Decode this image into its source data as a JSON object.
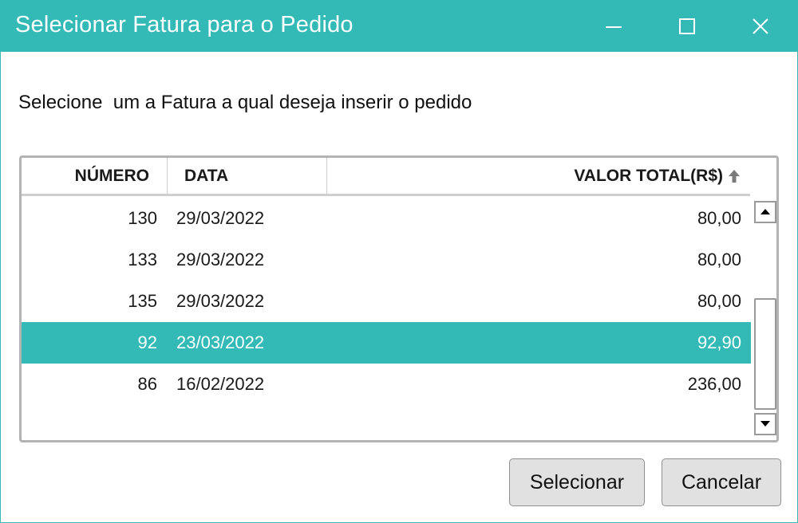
{
  "window": {
    "title": "Selecionar Fatura para o Pedido",
    "accent_color": "#34bab6"
  },
  "prompt": "Selecione  um a Fatura a qual deseja inserir o pedido",
  "grid": {
    "columns": [
      {
        "label": "NÚMERO"
      },
      {
        "label": "DATA"
      },
      {
        "label": "VALOR TOTAL(R$)",
        "sort": "ascending",
        "sort_icon": "arrow-up-icon"
      }
    ],
    "rows": [
      {
        "numero": "130",
        "data": "29/03/2022",
        "valor": "80,00",
        "selected": false
      },
      {
        "numero": "133",
        "data": "29/03/2022",
        "valor": "80,00",
        "selected": false
      },
      {
        "numero": "135",
        "data": "29/03/2022",
        "valor": "80,00",
        "selected": false
      },
      {
        "numero": "92",
        "data": "23/03/2022",
        "valor": "92,90",
        "selected": true
      },
      {
        "numero": "86",
        "data": "16/02/2022",
        "valor": "236,00",
        "selected": false
      }
    ]
  },
  "buttons": {
    "select_label": "Selecionar",
    "cancel_label": "Cancelar"
  }
}
